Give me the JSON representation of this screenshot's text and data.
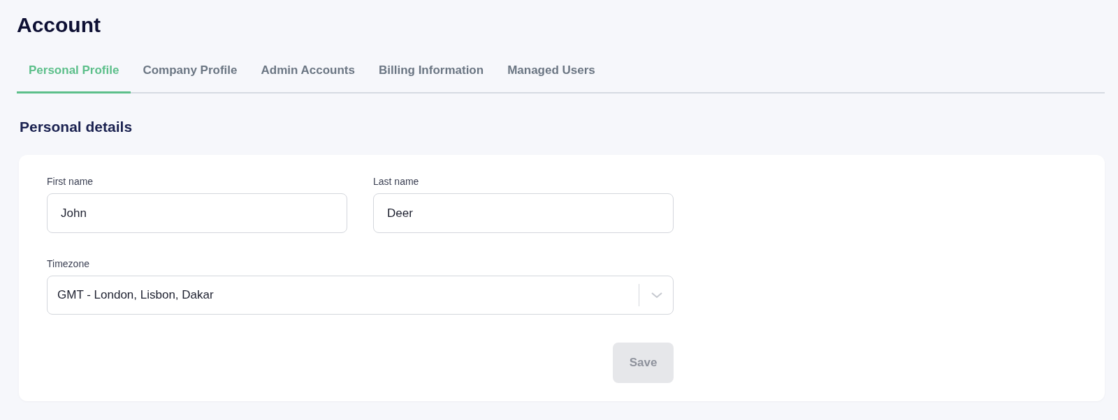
{
  "page": {
    "title": "Account"
  },
  "tabs": [
    {
      "label": "Personal Profile",
      "selected": true
    },
    {
      "label": "Company Profile",
      "selected": false
    },
    {
      "label": "Admin Accounts",
      "selected": false
    },
    {
      "label": "Billing Information",
      "selected": false
    },
    {
      "label": "Managed Users",
      "selected": false
    }
  ],
  "section": {
    "title": "Personal details"
  },
  "form": {
    "first_name": {
      "label": "First name",
      "value": "John"
    },
    "last_name": {
      "label": "Last name",
      "value": "Deer"
    },
    "timezone": {
      "label": "Timezone",
      "value": "GMT - London, Lisbon, Dakar"
    },
    "save_button": {
      "label": "Save",
      "disabled": true
    }
  }
}
